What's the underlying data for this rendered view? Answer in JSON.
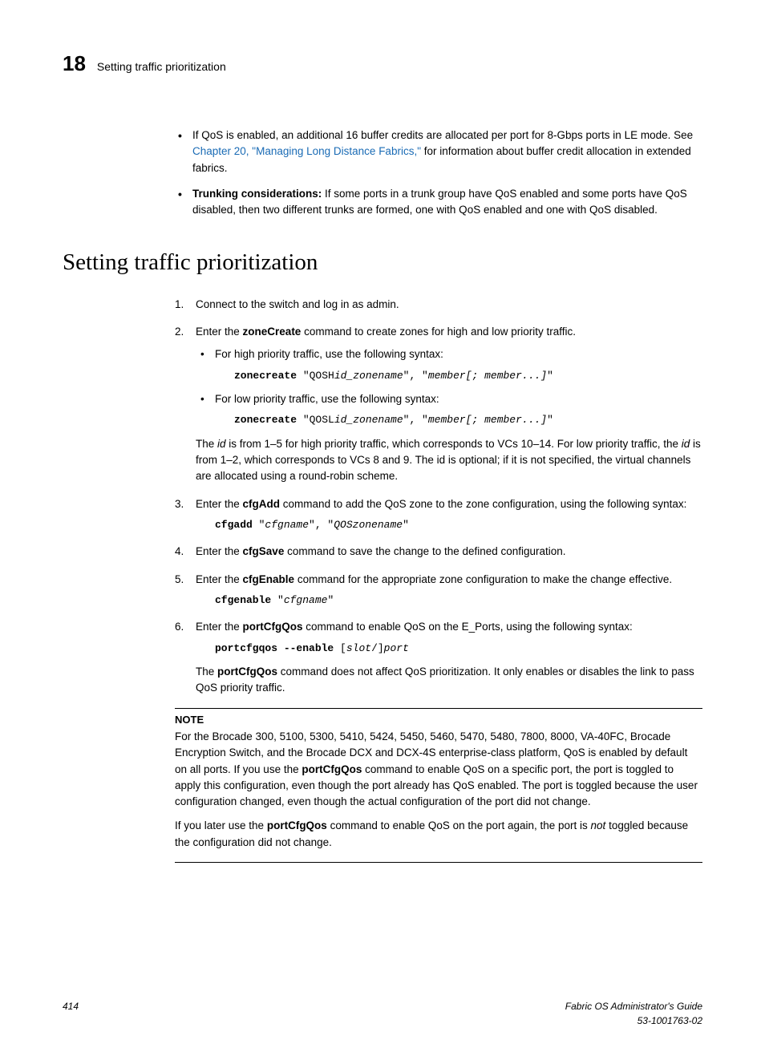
{
  "header": {
    "chapterNumber": "18",
    "runningTitle": "Setting traffic prioritization"
  },
  "intro": {
    "bullets": [
      {
        "pre": "If QoS is enabled, an additional 16 buffer credits are allocated per port for 8-Gbps ports in LE mode. See ",
        "link": "Chapter 20, \"Managing Long Distance Fabrics,\"",
        "post": " for information about buffer credit allocation in extended fabrics."
      },
      {
        "boldLead": "Trunking considerations:",
        "rest": " If some ports in a trunk group have QoS enabled and some ports have QoS disabled, then two different trunks are formed, one with QoS enabled and one with QoS disabled."
      }
    ]
  },
  "heading": "Setting traffic prioritization",
  "steps": {
    "s1": "Connect to the switch and log in as admin.",
    "s2_pre": "Enter the ",
    "s2_cmd": "zoneCreate",
    "s2_post": " command to create zones for high and low priority traffic.",
    "s2_high_label": "For high priority traffic, use the following syntax:",
    "s2_high_code": {
      "kw": "zonecreate",
      "tail": " \"QOSH",
      "it1": "id_zonename",
      "mid": "\", \"",
      "it2": "member[; member...]",
      "end": "\""
    },
    "s2_low_label": "For low priority traffic, use the following syntax:",
    "s2_low_code": {
      "kw": "zonecreate",
      "tail": " \"QOSL",
      "it1": "id_zonename",
      "mid": "\", \"",
      "it2": "member[; member...]",
      "end": "\""
    },
    "s2_expl_a": "The ",
    "s2_expl_id1": "id",
    "s2_expl_b": " is from 1–5 for high priority traffic, which corresponds to VCs 10–14. For low priority traffic, the ",
    "s2_expl_id2": "id",
    "s2_expl_c": " is from 1–2, which corresponds to VCs 8 and 9. The id is optional; if it is not specified, the virtual channels are allocated using a round-robin scheme.",
    "s3_pre": "Enter the ",
    "s3_cmd": "cfgAdd",
    "s3_post": " command to add the QoS zone to the zone configuration, using the following syntax:",
    "s3_code": {
      "kw": "cfgadd",
      "q1": " \"",
      "it1": "cfgname",
      "mid": "\", \"",
      "it2": "QOSzonename",
      "end": "\""
    },
    "s4_pre": "Enter the ",
    "s4_cmd": "cfgSave",
    "s4_post": " command to save the change to the defined configuration.",
    "s5_pre": "Enter the ",
    "s5_cmd": "cfgEnable",
    "s5_post": " command for the appropriate zone configuration to make the change effective.",
    "s5_code": {
      "kw": "cfgenable",
      "q1": " \"",
      "it1": "cfgname",
      "end": "\""
    },
    "s6_pre": "Enter the ",
    "s6_cmd": "portCfgQos",
    "s6_post": " command to enable QoS on the E_Ports, using the following syntax:",
    "s6_code": {
      "kw": "portcfgqos --enable",
      "sp": " [",
      "it1": "slot",
      "mid": "/]",
      "it2": "port"
    },
    "s6_out_a": "The ",
    "s6_out_cmd": "portCfgQos",
    "s6_out_b": " command does not affect QoS prioritization. It only enables or disables the link to pass QoS priority traffic."
  },
  "note": {
    "label": "NOTE",
    "p1_a": "For the Brocade 300, 5100, 5300, 5410, 5424, 5450, 5460, 5470, 5480, 7800, 8000, VA-40FC, Brocade Encryption Switch, and the Brocade DCX and DCX-4S enterprise-class platform, QoS is enabled by default on all ports. If you use the ",
    "p1_cmd": "portCfgQos",
    "p1_b": " command to enable QoS on a specific port, the port is toggled to apply this configuration, even though the port already has QoS enabled. The port is toggled because the user configuration changed, even though the actual configuration of the port did not change.",
    "p2_a": "If you later use the ",
    "p2_cmd": "portCfgQos",
    "p2_b": " command to enable QoS on the port again, the port is ",
    "p2_not": "not",
    "p2_c": " toggled because the configuration did not change."
  },
  "footer": {
    "pageNum": "414",
    "guide": "Fabric OS Administrator's Guide",
    "docnum": "53-1001763-02"
  }
}
